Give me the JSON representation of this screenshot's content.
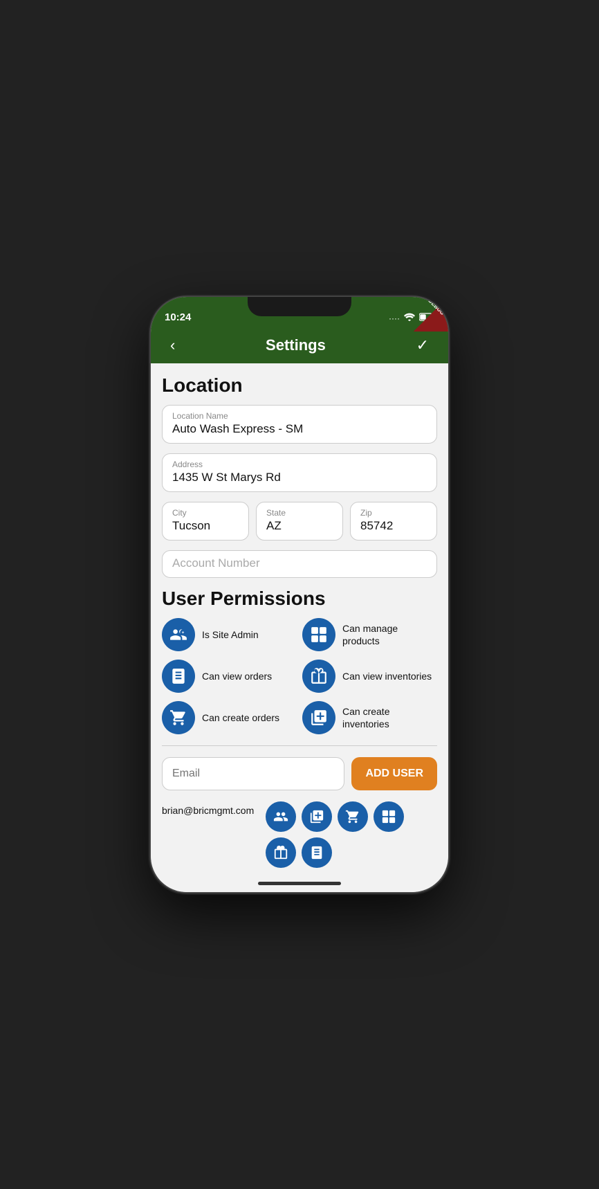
{
  "status_bar": {
    "time": "10:24",
    "debug_label": "DEBUG"
  },
  "header": {
    "title": "Settings",
    "back_label": "‹",
    "confirm_label": "✓"
  },
  "location": {
    "section_title": "Location",
    "name_label": "Location Name",
    "name_value": "Auto Wash Express - SM",
    "address_label": "Address",
    "address_value": "1435 W St Marys Rd",
    "city_label": "City",
    "city_value": "Tucson",
    "state_label": "State",
    "state_value": "AZ",
    "zip_label": "Zip",
    "zip_value": "85742",
    "account_number_placeholder": "Account Number"
  },
  "user_permissions": {
    "section_title": "User Permissions",
    "permissions": [
      {
        "id": "is_site_admin",
        "label": "Is Site Admin",
        "col": 0
      },
      {
        "id": "can_manage_products",
        "label": "Can manage products",
        "col": 1
      },
      {
        "id": "can_view_orders",
        "label": "Can view orders",
        "col": 0
      },
      {
        "id": "can_view_inventories",
        "label": "Can view inventories",
        "col": 1
      },
      {
        "id": "can_create_orders",
        "label": "Can create orders",
        "col": 0
      },
      {
        "id": "can_create_inventories",
        "label": "Can create inventories",
        "col": 1
      }
    ]
  },
  "add_user": {
    "email_placeholder": "Email",
    "button_label": "ADD USER"
  },
  "users": [
    {
      "email": "brian@bricmgmt.com",
      "permissions": [
        "site_admin",
        "create_inventories",
        "create_orders",
        "manage_products",
        "view_inventories",
        "view_orders"
      ]
    }
  ],
  "colors": {
    "green": "#2a5c1e",
    "blue": "#1a5fa8",
    "orange": "#e08020"
  }
}
